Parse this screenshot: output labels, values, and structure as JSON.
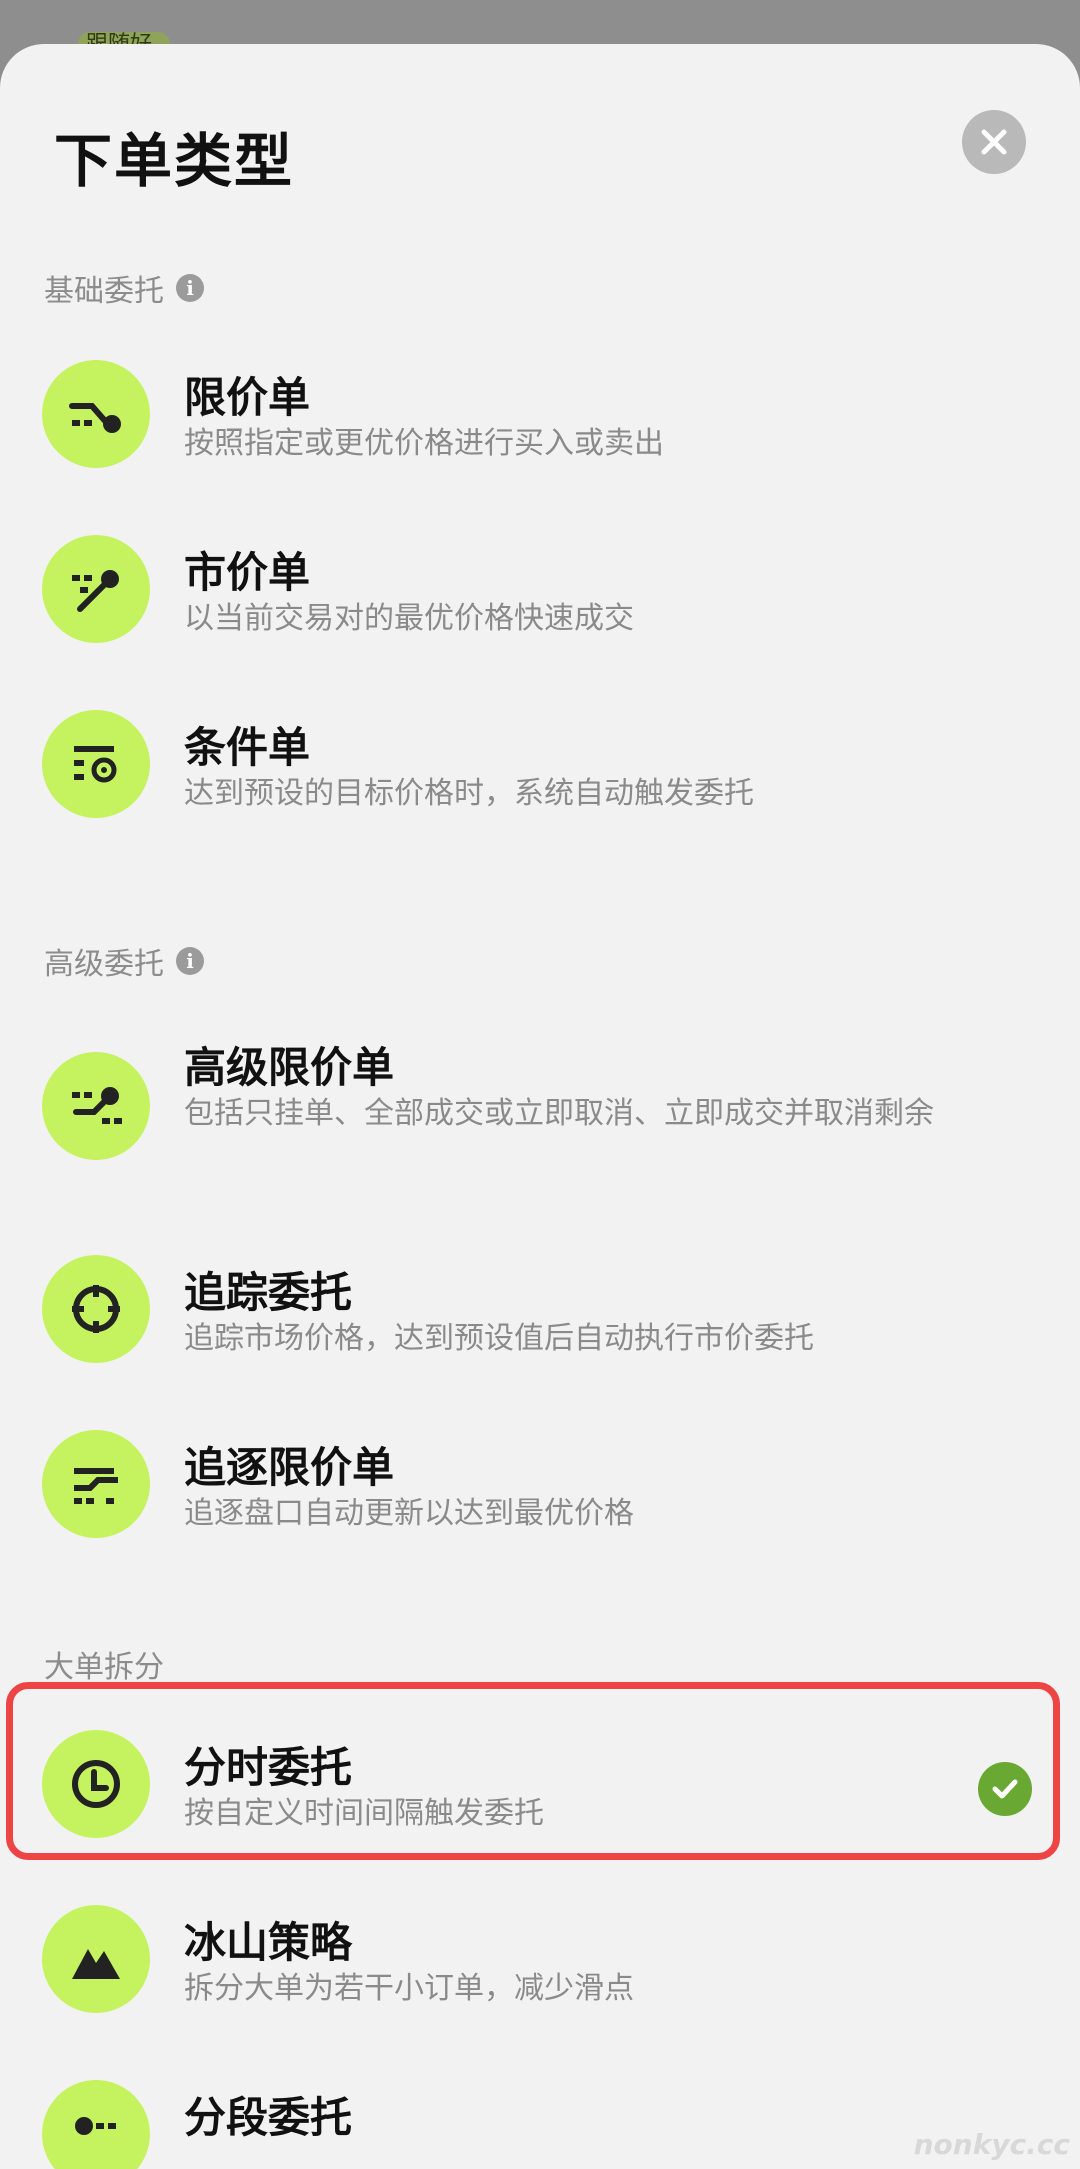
{
  "backdrop": {
    "tag_text": "跟随好"
  },
  "sheet": {
    "title": "下单类型",
    "close_icon": "close-icon"
  },
  "sections": [
    {
      "label": "基础委托",
      "info": "i",
      "items": [
        {
          "title": "限价单",
          "desc": "按照指定或更优价格进行买入或卖出",
          "icon": "limit-order-icon"
        },
        {
          "title": "市价单",
          "desc": "以当前交易对的最优价格快速成交",
          "icon": "market-order-icon"
        },
        {
          "title": "条件单",
          "desc": "达到预设的目标价格时，系统自动触发委托",
          "icon": "conditional-order-icon"
        }
      ]
    },
    {
      "label": "高级委托",
      "info": "i",
      "items": [
        {
          "title": "高级限价单",
          "desc": "包括只挂单、全部成交或立即取消、立即成交并取消剩余",
          "icon": "advanced-limit-icon"
        },
        {
          "title": "追踪委托",
          "desc": "追踪市场价格，达到预设值后自动执行市价委托",
          "icon": "trailing-order-icon"
        },
        {
          "title": "追逐限价单",
          "desc": "追逐盘口自动更新以达到最优价格",
          "icon": "chase-limit-icon"
        }
      ]
    },
    {
      "label": "大单拆分",
      "items": [
        {
          "title": "分时委托",
          "desc": "按自定义时间间隔触发委托",
          "icon": "clock-icon",
          "selected": true
        },
        {
          "title": "冰山策略",
          "desc": "拆分大单为若干小订单，减少滑点",
          "icon": "iceberg-icon"
        },
        {
          "title": "分段委托",
          "desc": "",
          "icon": "segmented-order-icon"
        }
      ]
    }
  ],
  "watermark": "nonkyc.cc",
  "colors": {
    "accent": "#c4f35f",
    "check": "#6aa834",
    "highlight": "#ee4444"
  }
}
